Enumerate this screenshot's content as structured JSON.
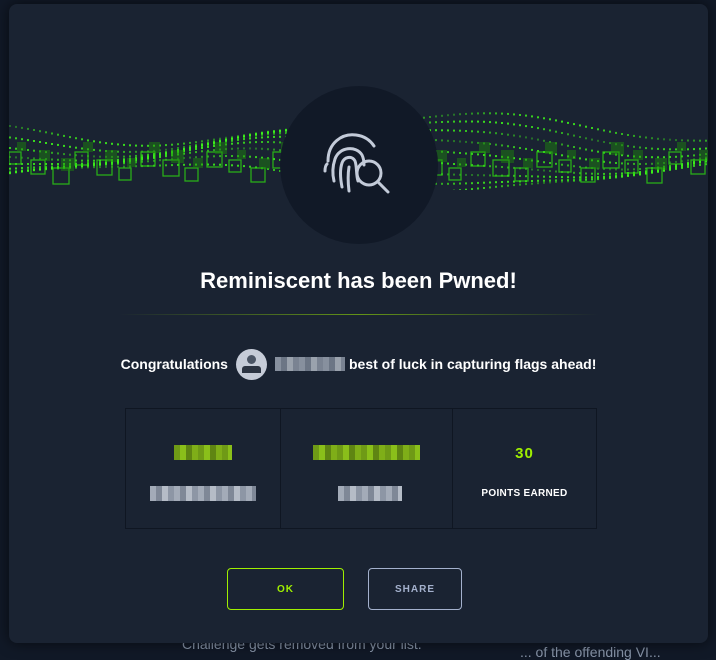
{
  "background": {
    "left_text": "Challenge gets removed from your list.",
    "right_text": "... of the offending VI..."
  },
  "modal": {
    "title": "Reminiscent has been Pwned!",
    "emblem_icon": "fingerprint-search-icon",
    "congrats": {
      "prefix": "Congratulations",
      "suffix": "best of luck in capturing flags ahead!"
    },
    "stats": [
      {
        "value": "30",
        "label": "POINTS EARNED"
      }
    ],
    "buttons": {
      "ok_label": "OK",
      "share_label": "SHARE"
    }
  },
  "colors": {
    "accent": "#9fef00",
    "modal_bg": "#1a2332",
    "page_bg": "#111927",
    "secondary_button": "#a4b1cd"
  }
}
